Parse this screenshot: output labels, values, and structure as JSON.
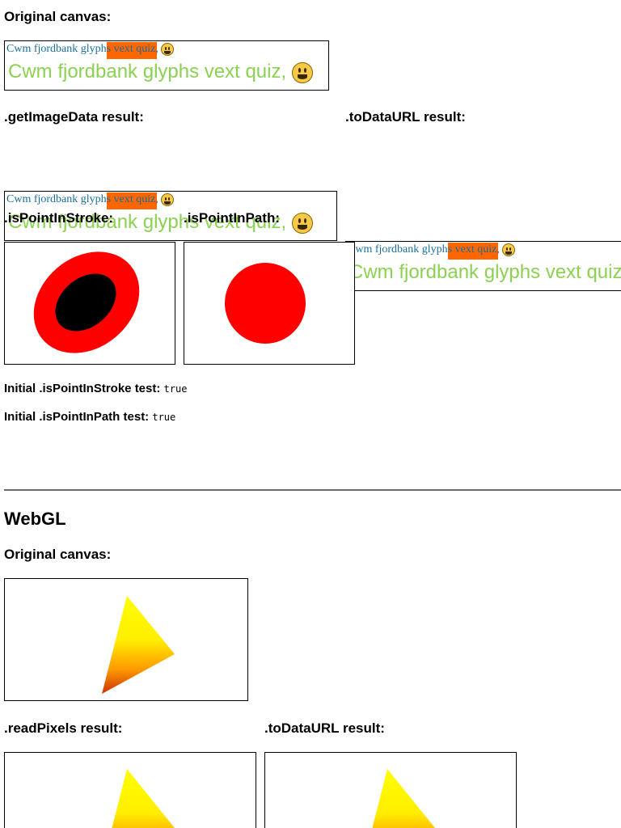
{
  "canvas2d": {
    "original_heading": "Original canvas:",
    "sample_text_small": "Cwm fjordbank glyphs vext quiz,",
    "sample_text_large": "Cwm fjordbank glyphs vext quiz,",
    "emoji_icon": "grinning-face-emoji",
    "get_image_data_heading": ".getImageData result:",
    "to_data_url_heading": ".toDataURL result:",
    "is_point_in_stroke_heading": ".isPointInStroke:",
    "is_point_in_path_heading": ".isPointInPath:",
    "initial_stroke_test_label": "Initial .isPointInStroke test:",
    "initial_stroke_test_value": "true",
    "initial_path_test_label": "Initial .isPointInPath test:",
    "initial_path_test_value": "true",
    "colors": {
      "small_text": "#1a6e9a",
      "large_text": "#8bd152",
      "highlight": "#ff6600",
      "shape_red": "#ff0000",
      "shape_black": "#000000"
    }
  },
  "webgl": {
    "section_title": "WebGL",
    "original_heading": "Original canvas:",
    "read_pixels_heading": ".readPixels result:",
    "to_data_url_heading": ".toDataURL result:",
    "colors": {
      "triangle_top": "#ffff00",
      "triangle_bottom": "#cc3300"
    }
  }
}
